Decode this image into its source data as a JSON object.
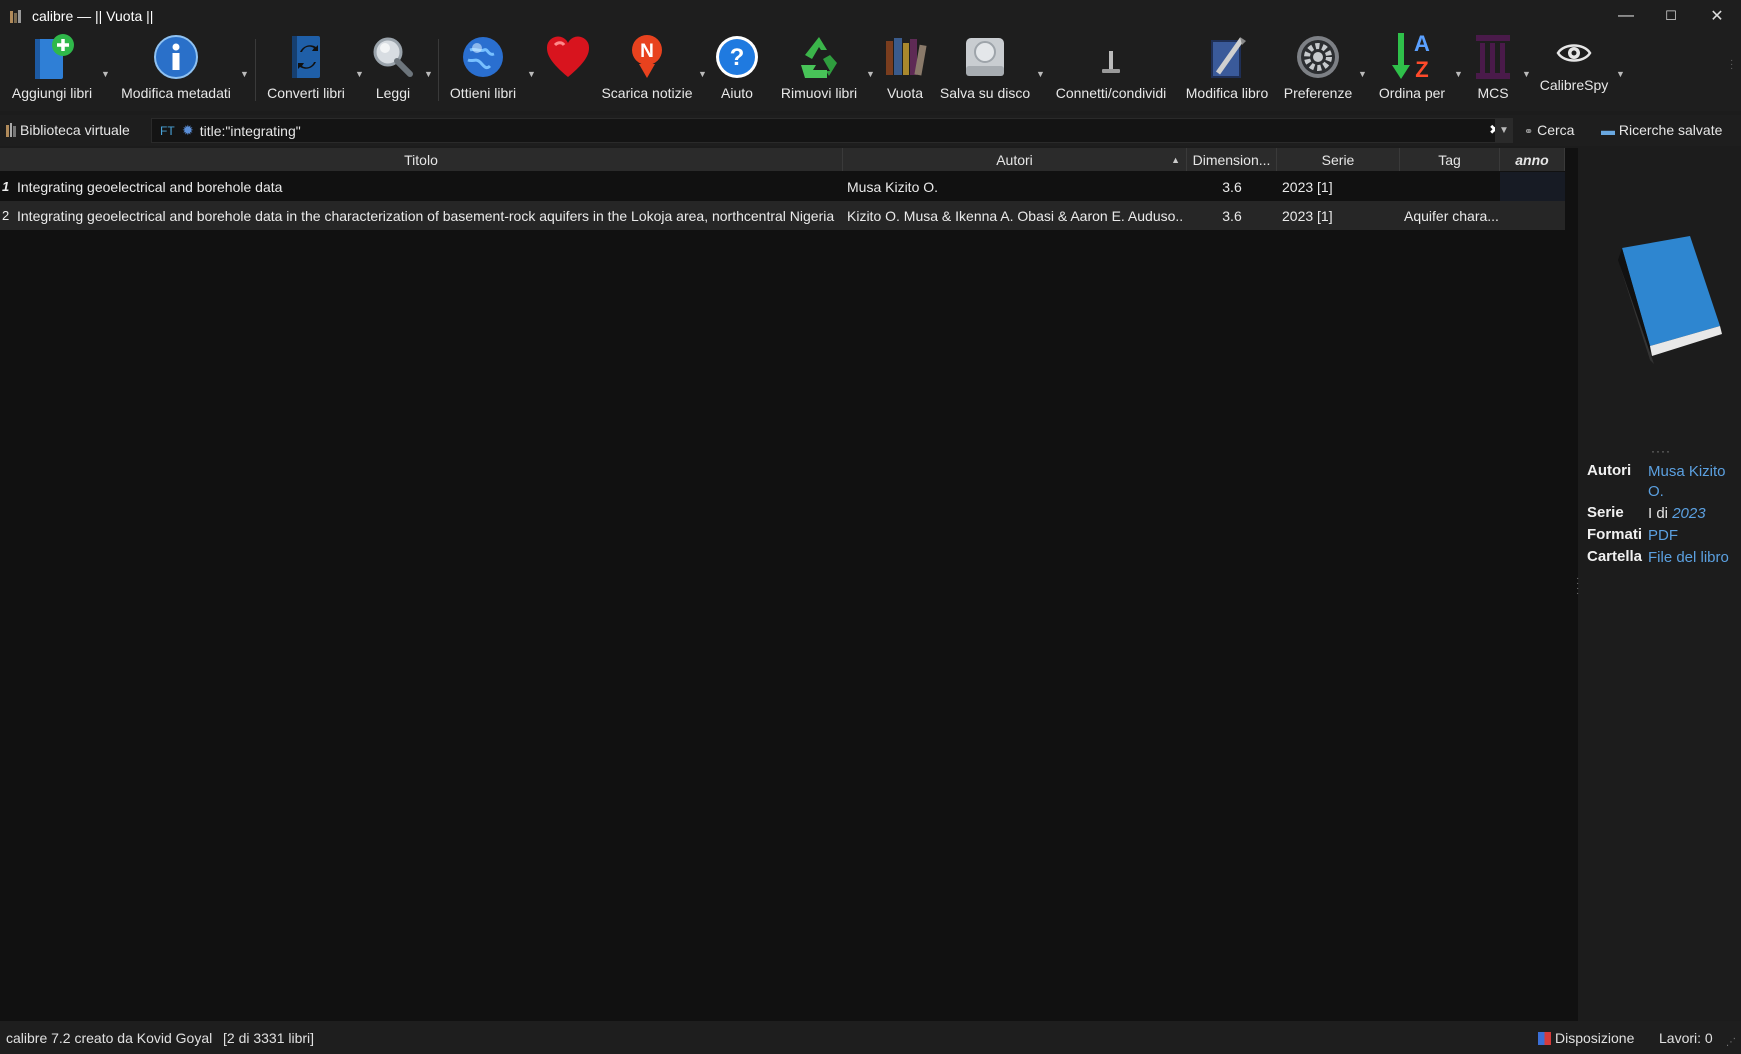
{
  "window": {
    "title": "calibre — || Vuota ||",
    "minimize": "—",
    "maximize": "☐",
    "close": "✕"
  },
  "toolbar": {
    "items": [
      {
        "label": "Aggiungi libri",
        "icon": "add-book-icon"
      },
      {
        "label": "Modifica metadati",
        "icon": "info-icon"
      },
      {
        "label": "Converti libri",
        "icon": "convert-icon"
      },
      {
        "label": "Leggi",
        "icon": "magnifier-icon"
      },
      {
        "label": "Ottieni libri",
        "icon": "globe-icon"
      },
      {
        "label": "",
        "icon": "heart-icon"
      },
      {
        "label": "Scarica notizie",
        "icon": "news-icon"
      },
      {
        "label": "Aiuto",
        "icon": "help-icon"
      },
      {
        "label": "Rimuovi libri",
        "icon": "recycle-icon"
      },
      {
        "label": "Vuota",
        "icon": "library-icon"
      },
      {
        "label": "Salva su disco",
        "icon": "disk-icon"
      },
      {
        "label": "Connetti/condividi",
        "icon": "connect-icon"
      },
      {
        "label": "Modifica libro",
        "icon": "edit-book-icon"
      },
      {
        "label": "Preferenze",
        "icon": "gear-icon"
      },
      {
        "label": "Ordina per",
        "icon": "sort-az-icon"
      },
      {
        "label": "MCS",
        "icon": "column-icon"
      },
      {
        "label": "CalibreSpy",
        "icon": "eye-icon"
      }
    ]
  },
  "search": {
    "virtual_library": "Biblioteca virtuale",
    "ft_label": "FT",
    "query": "title:\"integrating\"",
    "search_button": "Cerca",
    "saved_searches": "Ricerche salvate"
  },
  "table": {
    "columns": [
      "Titolo",
      "Autori",
      "Dimension...",
      "Serie",
      "Tag",
      "anno"
    ],
    "rows": [
      {
        "num": "1",
        "title": "Integrating geoelectrical and borehole data",
        "authors": "Musa Kizito O.",
        "size": "3.6",
        "series": "2023 [1]",
        "tags": "",
        "anno": ""
      },
      {
        "num": "2",
        "title": "Integrating geoelectrical and borehole data in the characterization of basement-rock aquifers in the Lokoja area, northcentral Nigeria",
        "authors": "Kizito O. Musa & Ikenna A. Obasi & Aaron E. Auduso...",
        "size": "3.6",
        "series": "2023 [1]",
        "tags": "Aquifer chara...",
        "anno": ""
      }
    ]
  },
  "details": {
    "authors_label": "Autori",
    "authors_value": "Musa Kizito O.",
    "series_label": "Serie",
    "series_prefix": "I di",
    "series_value": "2023",
    "formats_label": "Formati",
    "formats_value": "PDF",
    "folder_label": "Cartella",
    "folder_value": "File del libro"
  },
  "status": {
    "left": "calibre 7.2 creato da Kovid Goyal",
    "count": "[2 di 3331 libri]",
    "layout": "Disposizione",
    "jobs": "Lavori: 0"
  },
  "colors": {
    "background": "#111111",
    "link": "#5ba0e0",
    "toolbar": "#1e1e1e"
  }
}
